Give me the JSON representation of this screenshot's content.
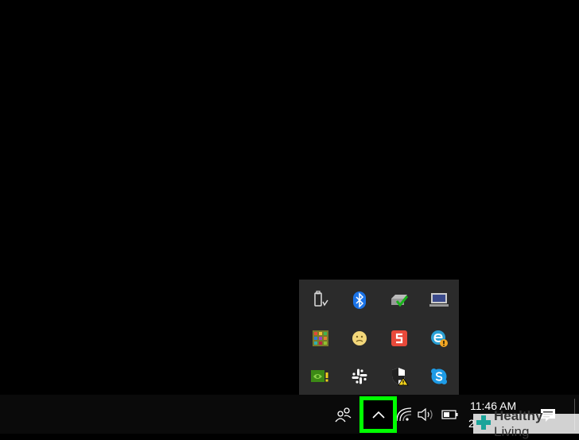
{
  "clock": {
    "time": "11:46 AM",
    "date_partial": "2"
  },
  "watermark": {
    "bold": "Healthy",
    "light": " Living"
  },
  "tray_popup": {
    "icons": [
      "usb-drive-icon",
      "bluetooth-icon",
      "network-check-icon",
      "laptop-display-icon",
      "color-grid-icon",
      "sync-face-icon",
      "snagit-icon",
      "edge-beta-icon",
      "nvidia-warning-icon",
      "slack-icon",
      "defender-warning-icon",
      "skype-icon"
    ]
  },
  "taskbar": {
    "icons": [
      "people-icon",
      "chevron-up-icon",
      "wifi-icon",
      "volume-icon",
      "battery-icon",
      "notification-icon"
    ]
  },
  "colors": {
    "highlight": "#00ff00",
    "popup_bg": "#2b2b2b",
    "taskbar_bg": "#0a0a0a",
    "bluetooth_blue": "#1a73e8",
    "snagit_red": "#e8493a",
    "skype_blue": "#1e9be6"
  }
}
